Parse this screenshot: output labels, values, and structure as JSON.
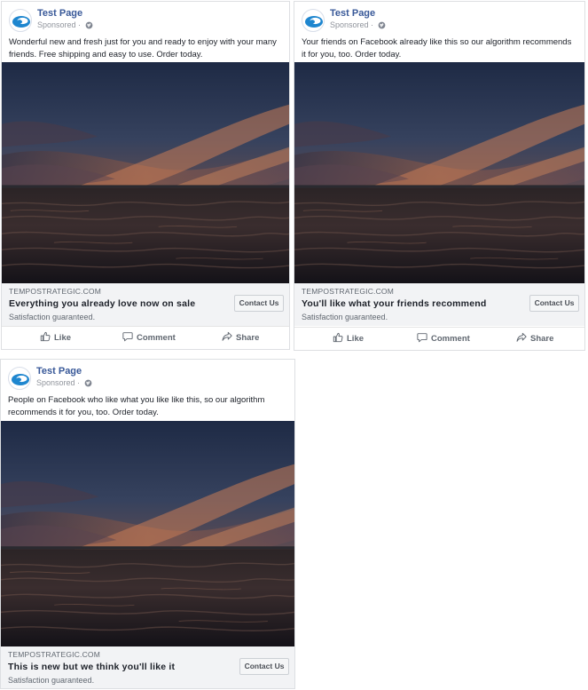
{
  "colors": {
    "page_name": "#385898",
    "footer_bg": "#f2f3f5",
    "border": "#dddfe2",
    "text_primary": "#1d2129",
    "text_secondary": "#606770"
  },
  "ads": [
    {
      "page_name": "Test Page",
      "sponsored": "Sponsored ·",
      "message": "Wonderful new and fresh just for you and ready to enjoy with your many friends. Free shipping and easy to use. Order today.",
      "domain": "TEMPOSTRATEGIC.COM",
      "headline": "Everything you already love now on sale",
      "subline": "Satisfaction guaranteed.",
      "cta": "Contact Us",
      "actions": {
        "like": "Like",
        "comment": "Comment",
        "share": "Share"
      }
    },
    {
      "page_name": "Test Page",
      "sponsored": "Sponsored ·",
      "message": "Your friends on Facebook already like this so our algorithm recommends it for you, too. Order today.",
      "domain": "TEMPOSTRATEGIC.COM",
      "headline": "You'll like what your friends recommend",
      "subline": "Satisfaction guaranteed.",
      "cta": "Contact Us",
      "actions": {
        "like": "Like",
        "comment": "Comment",
        "share": "Share"
      }
    },
    {
      "page_name": "Test Page",
      "sponsored": "Sponsored ·",
      "message": "People on Facebook who like what you like like this, so our algorithm recommends it for you, too. Order today.",
      "domain": "TEMPOSTRATEGIC.COM",
      "headline": "This is new but we think you'll like it",
      "subline": "Satisfaction guaranteed.",
      "cta": "Contact Us"
    }
  ],
  "icons": {
    "avatar": "swirl-logo-icon",
    "audience": "globe-icon",
    "like": "thumbs-up-icon",
    "comment": "speech-bubble-icon",
    "share": "share-arrow-icon"
  }
}
